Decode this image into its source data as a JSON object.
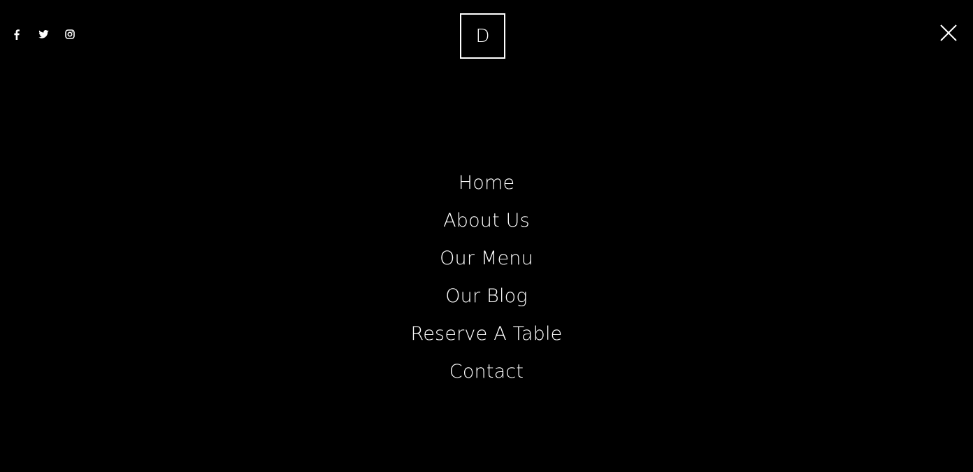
{
  "colors": {
    "background": "#000000",
    "foreground": "#ffffff"
  },
  "social": [
    {
      "icon": "facebook-icon"
    },
    {
      "icon": "twitter-icon"
    },
    {
      "icon": "instagram-icon"
    }
  ],
  "logo": {
    "letter": "D"
  },
  "close": {
    "icon": "close-icon"
  },
  "menu": {
    "items": [
      {
        "label": "Home"
      },
      {
        "label": "About Us"
      },
      {
        "label": "Our Menu"
      },
      {
        "label": "Our Blog"
      },
      {
        "label": "Reserve A Table"
      },
      {
        "label": "Contact"
      }
    ]
  }
}
